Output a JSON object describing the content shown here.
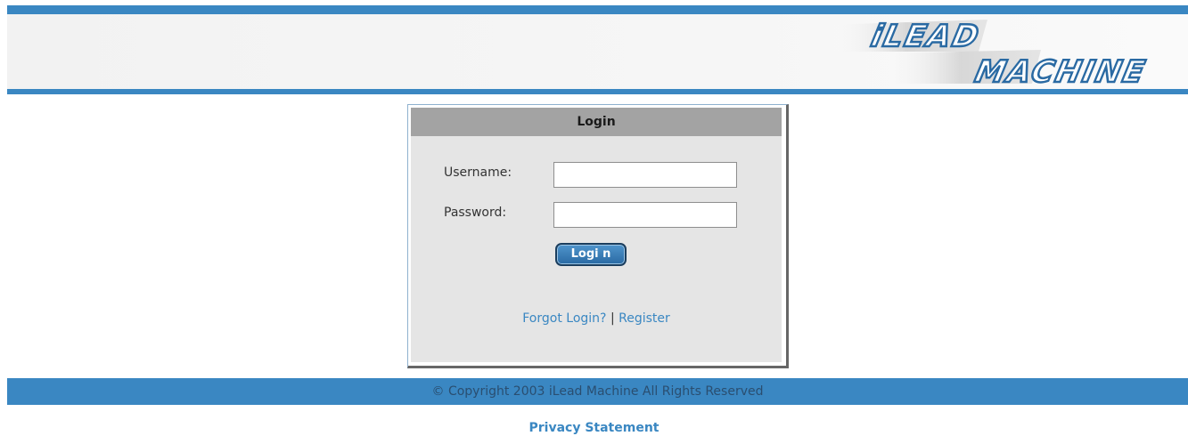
{
  "header": {
    "logo_line1": "iLEAD",
    "logo_line2": "MACHINE"
  },
  "login": {
    "title": "Login",
    "username_label": "Username:",
    "username_value": "",
    "password_label": "Password:",
    "password_value": "",
    "submit_label": "Logi n",
    "forgot_link": "Forgot Login?",
    "separator": "|",
    "register_link": "Register"
  },
  "footer": {
    "copyright": "© Copyright 2003 iLead Machine All Rights Reserved",
    "privacy_link": "Privacy Statement"
  },
  "colors": {
    "accent": "#3a87c2",
    "panel": "#e5e5e5",
    "title_bar": "#a3a3a3"
  }
}
